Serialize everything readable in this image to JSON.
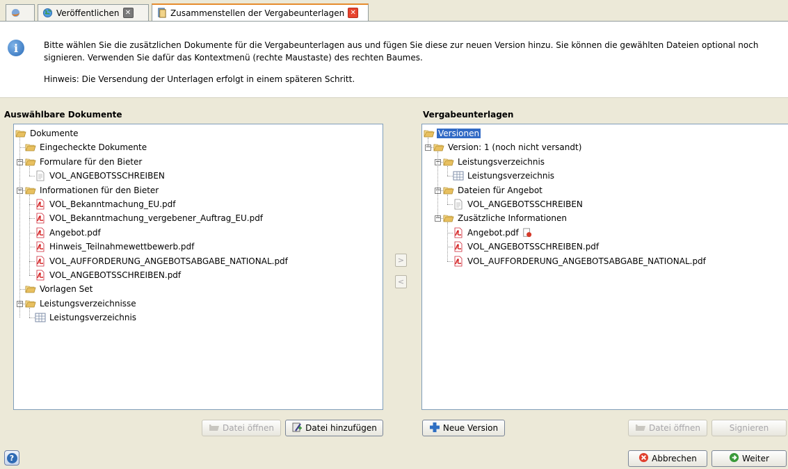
{
  "tabs": {
    "first_icon": "firefox-like-icon",
    "tab1_label": "Veröffentlichen",
    "tab2_label": "Zusammenstellen der Vergabeunterlagen"
  },
  "info": {
    "line1": "Bitte wählen Sie die zusätzlichen Dokumente für die Vergabeunterlagen aus und fügen Sie diese zur neuen Version hinzu. Sie können die gewählten Dateien optional noch signieren. Verwenden Sie dafür das Kontextmenü (rechte Maustaste) des rechten Baumes.",
    "hint": "Hinweis: Die Versendung der Unterlagen erfolgt in einem späteren Schritt."
  },
  "left": {
    "title": "Auswählbare Dokumente",
    "tree": [
      {
        "label": "Dokumente",
        "icon": "folder-icon"
      },
      {
        "label": "Eingecheckte Dokumente",
        "icon": "folder-icon"
      },
      {
        "label": "Formulare für den Bieter",
        "icon": "folder-icon"
      },
      {
        "label": "VOL_ANGEBOTSSCHREIBEN",
        "icon": "document-icon"
      },
      {
        "label": "Informationen für den Bieter",
        "icon": "folder-icon"
      },
      {
        "label": "VOL_Bekanntmachung_EU.pdf",
        "icon": "pdf-icon"
      },
      {
        "label": "VOL_Bekanntmachung_vergebener_Auftrag_EU.pdf",
        "icon": "pdf-icon"
      },
      {
        "label": "Angebot.pdf",
        "icon": "pdf-icon"
      },
      {
        "label": "Hinweis_Teilnahmewettbewerb.pdf",
        "icon": "pdf-icon"
      },
      {
        "label": "VOL_AUFFORDERUNG_ANGEBOTSABGABE_NATIONAL.pdf",
        "icon": "pdf-icon"
      },
      {
        "label": "VOL_ANGEBOTSSCHREIBEN.pdf",
        "icon": "pdf-icon"
      },
      {
        "label": "Vorlagen Set",
        "icon": "folder-icon"
      },
      {
        "label": "Leistungsverzeichnisse",
        "icon": "folder-icon"
      },
      {
        "label": "Leistungsverzeichnis",
        "icon": "table-icon"
      }
    ],
    "btn_open": "Datei öffnen",
    "btn_add": "Datei hinzufügen"
  },
  "right": {
    "title": "Vergabeunterlagen",
    "tree": [
      {
        "label": "Versionen",
        "icon": "folder-icon"
      },
      {
        "label": "Version: 1 (noch nicht versandt)",
        "icon": "folder-icon"
      },
      {
        "label": "Leistungsverzeichnis",
        "icon": "folder-icon"
      },
      {
        "label": "Leistungsverzeichnis",
        "icon": "table-icon"
      },
      {
        "label": "Dateien für Angebot",
        "icon": "folder-icon"
      },
      {
        "label": "VOL_ANGEBOTSSCHREIBEN",
        "icon": "document-icon"
      },
      {
        "label": "Zusätzliche Informationen",
        "icon": "folder-icon"
      },
      {
        "label": "Angebot.pdf",
        "icon": "pdf-icon"
      },
      {
        "label": "VOL_ANGEBOTSSCHREIBEN.pdf",
        "icon": "pdf-icon"
      },
      {
        "label": "VOL_AUFFORDERUNG_ANGEBOTSABGABE_NATIONAL.pdf",
        "icon": "pdf-icon"
      }
    ],
    "btn_new": "Neue Version",
    "btn_open": "Datei öffnen",
    "btn_sign": "Signieren"
  },
  "arrows": {
    "add": ">",
    "remove": "<"
  },
  "footer": {
    "help": "?",
    "cancel": "Abbrechen",
    "next": "Weiter"
  },
  "colors": {
    "selection": "#316ac5",
    "accent_tab": "#e68b2c",
    "pdf": "#d42020",
    "close": "#e8432e"
  }
}
